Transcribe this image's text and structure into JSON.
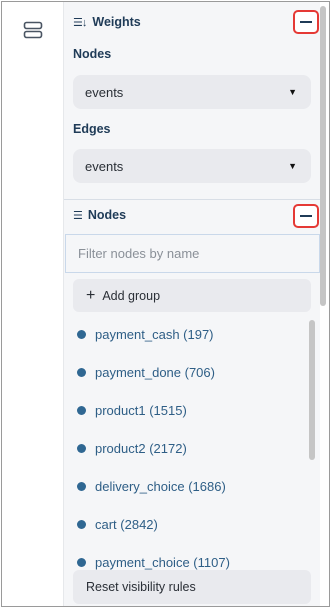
{
  "weights": {
    "title": "Weights",
    "nodes_label": "Nodes",
    "nodes_select_value": "events",
    "edges_label": "Edges",
    "edges_select_value": "events"
  },
  "nodes": {
    "title": "Nodes",
    "filter_placeholder": "Filter nodes by name",
    "add_group_label": "Add group",
    "items": [
      {
        "label": "payment_cash (197)"
      },
      {
        "label": "payment_done (706)"
      },
      {
        "label": "product1 (1515)"
      },
      {
        "label": "product2 (2172)"
      },
      {
        "label": "delivery_choice (1686)"
      },
      {
        "label": "cart (2842)"
      },
      {
        "label": "payment_choice (1107)"
      }
    ],
    "reset_label": "Reset visibility rules"
  },
  "icons": {
    "rail": "layers-icon",
    "weights": "sort-icon",
    "nodes": "list-icon",
    "collapse": "minus-icon",
    "dropdown": "caret-down-icon",
    "add": "plus-icon"
  },
  "colors": {
    "accent_text": "#2e5e86",
    "node_dot": "#2f6792",
    "highlight_border": "#e53935",
    "panel_bg": "#f5f6f8"
  }
}
